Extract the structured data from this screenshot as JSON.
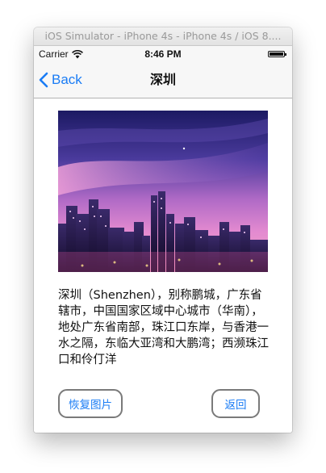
{
  "window": {
    "title": "iOS Simulator - iPhone 4s - iPhone 4s / iOS 8...."
  },
  "status_bar": {
    "carrier": "Carrier",
    "time": "8:46 PM",
    "icons": [
      "wifi-icon",
      "battery-icon"
    ]
  },
  "nav_bar": {
    "back_label": "Back",
    "title": "深圳"
  },
  "content": {
    "image_subject": "Shenzhen city skyline at dusk",
    "description": "深圳（Shenzhen），别称鹏城，广东省辖市，中国国家区域中心城市（华南），地处广东省南部，珠江口东岸，与香港一水之隔，东临大亚湾和大鹏湾；西濒珠江口和伶仃洋",
    "restore_button": "恢复图片",
    "return_button": "返回"
  },
  "colors": {
    "ios_blue": "#1a7cf5",
    "button_border": "#7a7a7a"
  }
}
